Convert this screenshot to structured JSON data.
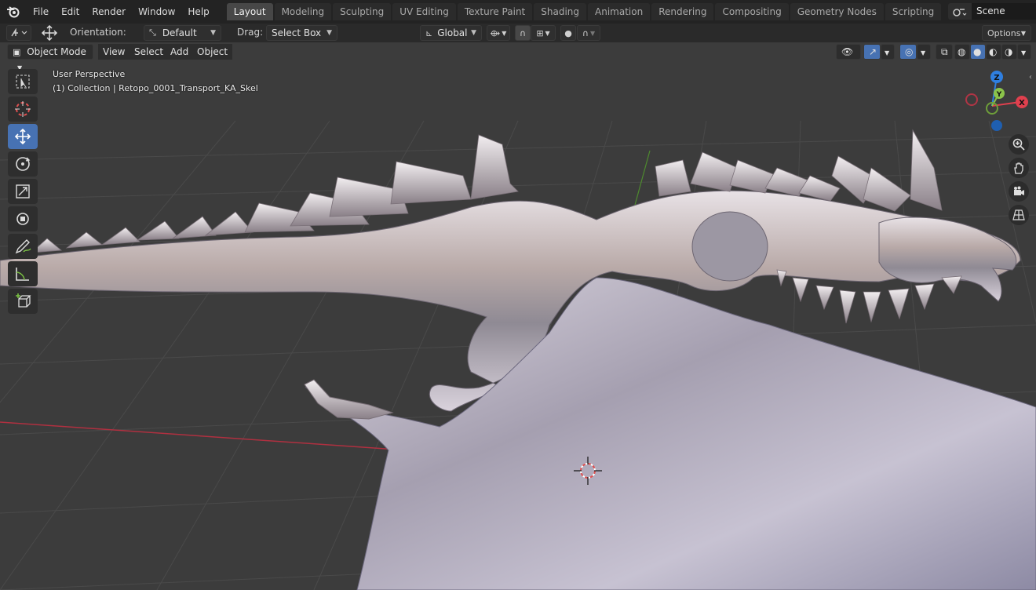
{
  "menu": {
    "items": [
      "File",
      "Edit",
      "Render",
      "Window",
      "Help"
    ]
  },
  "workspaces": [
    "Layout",
    "Modeling",
    "Sculpting",
    "UV Editing",
    "Texture Paint",
    "Shading",
    "Animation",
    "Rendering",
    "Compositing",
    "Geometry Nodes",
    "Scripting"
  ],
  "active_workspace": "Layout",
  "scene": {
    "name": "Scene"
  },
  "tool_header": {
    "orientation_label": "Orientation:",
    "orientation_value": "Default",
    "drag_label": "Drag:",
    "drag_value": "Select Box",
    "transform_orientation": "Global",
    "options_label": "Options"
  },
  "viewport_header": {
    "mode": "Object Mode",
    "menus": [
      "View",
      "Select",
      "Add",
      "Object"
    ]
  },
  "viewport": {
    "perspective": "User Perspective",
    "collection_info": "(1) Collection | Retopo_0001_Transport_KA_Skel"
  },
  "gizmo": {
    "z": "Z",
    "y": "Y",
    "x": "X"
  },
  "colors": {
    "accent": "#4772b3",
    "x_axis": "#e0404e",
    "y_axis": "#8bc34a",
    "z_axis": "#2f7fe0",
    "grid_bg": "#3c3c3c",
    "model": "#b8b0b8"
  },
  "icons": {
    "toolbar": [
      "select-box-icon",
      "cursor-icon",
      "move-icon",
      "rotate-icon",
      "scale-icon",
      "transform-icon",
      "annotate-icon",
      "measure-icon",
      "add-cube-icon"
    ],
    "nav": [
      "zoom-icon",
      "pan-hand-icon",
      "camera-icon",
      "grid-icon"
    ]
  }
}
